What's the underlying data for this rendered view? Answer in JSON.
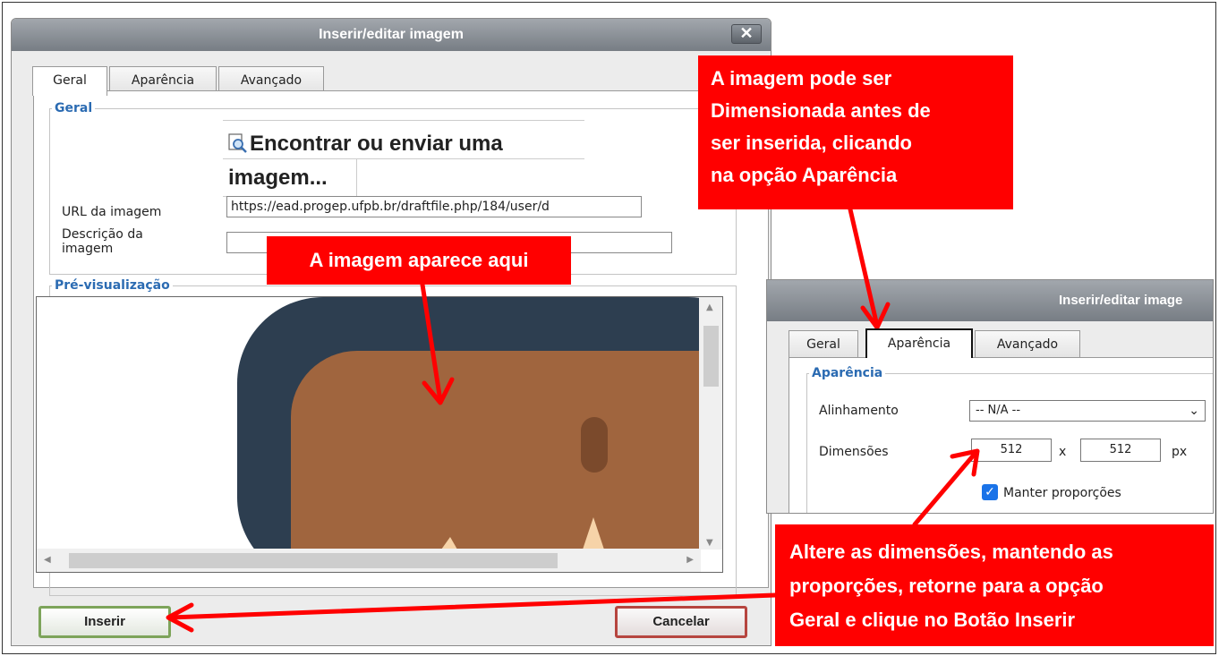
{
  "dialog": {
    "title": "Inserir/editar imagem",
    "close_label": "✕",
    "tabs": [
      "Geral",
      "Aparência",
      "Avançado"
    ],
    "general_legend": "Geral",
    "browse_label": "Encontrar ou enviar uma imagem...",
    "url_label": "URL da imagem",
    "url_value": "https://ead.progep.ufpb.br/draftfile.php/184/user/d",
    "desc_label_1": "Descrição da",
    "desc_label_2": "imagem",
    "desc_value": "",
    "preview_legend": "Pré-visualização",
    "insert_label": "Inserir",
    "cancel_label": "Cancelar"
  },
  "inset": {
    "title": "Inserir/editar image",
    "tabs": [
      "Geral",
      "Aparência",
      "Avançado"
    ],
    "legend": "Aparência",
    "align_label": "Alinhamento",
    "align_value": "-- N/A --",
    "dim_label": "Dimensões",
    "width_value": "512",
    "times": "x",
    "height_value": "512",
    "unit": "px",
    "keep_label": "Manter proporções",
    "keep_checked": true
  },
  "annotations": {
    "top_right": [
      "A imagem pode ser",
      "Dimensionada antes de",
      "ser inserida,  clicando",
      "na opção Aparência"
    ],
    "preview": "A imagem aparece aqui",
    "bottom_right": [
      "Altere as dimensões, mantendo as",
      "proporções, retorne para a opção",
      "Geral e clique no Botão Inserir"
    ]
  },
  "colors": {
    "accent_legend": "#2b6bb2",
    "annotation_red": "#ff0000",
    "preview_navy": "#2d3e50",
    "preview_skin": "#a0653e"
  }
}
